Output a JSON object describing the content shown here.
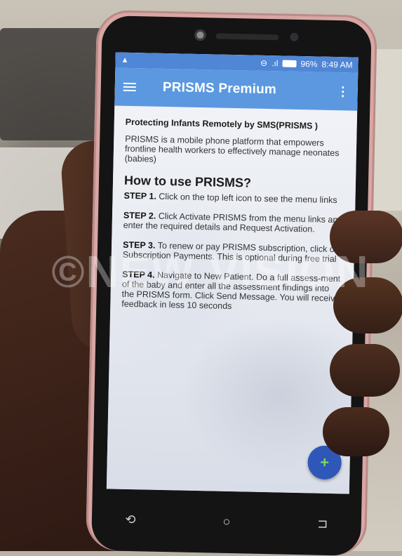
{
  "status_bar": {
    "battery": "96%",
    "time": "8:49 AM"
  },
  "app_bar": {
    "title": "PRISMS Premium"
  },
  "content": {
    "subtitle": "Protecting Infants Remotely by SMS(PRISMS )",
    "intro": "PRISMS is a mobile phone platform that empowers frontline health workers to effectively manage neonates (babies)",
    "howto_heading": "How to use PRISMS?",
    "steps": [
      {
        "label": "STEP 1.",
        "text": "Click on the top left icon to see the menu links"
      },
      {
        "label": "STEP 2.",
        "text": "Click Activate PRISMS from the menu links and enter the required details and Request Activation."
      },
      {
        "label": "STEP 3.",
        "text": "To renew or pay PRISMS subscription, click on Subscription Payments. This is optional during free trial"
      },
      {
        "label": "STEP 4.",
        "text": "Navigate to New Patient. Do a full assess-ment of the baby and enter all the assessment findings into the PRISMS form. Click Send Message. You will receive feedback in less 10 seconds"
      }
    ]
  },
  "fab": {
    "symbol": "+"
  },
  "nav": {
    "back": "⟲",
    "home": "○",
    "recents": "⊐"
  },
  "watermark": "©NEW VISION"
}
